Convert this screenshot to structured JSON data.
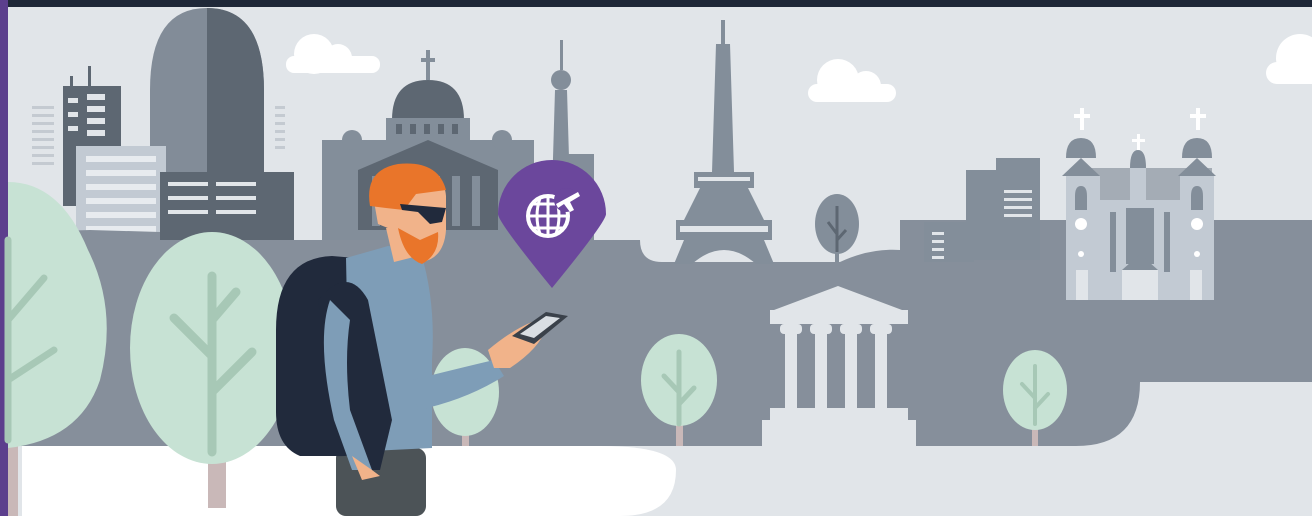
{
  "scene": {
    "subject": "traveler-with-smartphone",
    "landmarks": [
      "skyscraper-tower",
      "domed-cathedral",
      "tv-tower",
      "eiffel-tower",
      "greek-temple",
      "baroque-church"
    ],
    "pin_icon": "globe-airplane-icon"
  },
  "colors": {
    "topbar": "#1f2838",
    "sky": "#e1e5e9",
    "city_dark": "#5d6772",
    "city_mid": "#838e9a",
    "city_light": "#a4acb5",
    "street": "#868f9b",
    "tree": "#c7e2d4",
    "tree_branch": "#a7c8b6",
    "pin": "#6b479c",
    "beard": "#e9752a",
    "shirt": "#7e9db7",
    "backpack": "#212a3c",
    "accent_bar": "#5c3f8d"
  }
}
